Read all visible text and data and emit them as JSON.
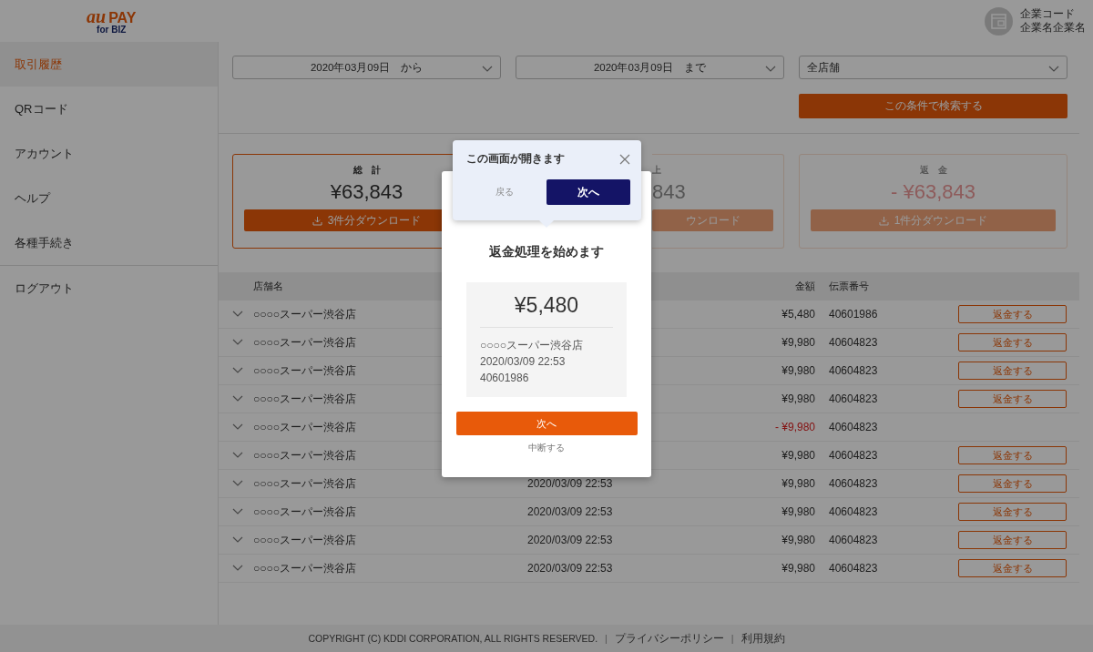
{
  "header": {
    "logo": {
      "brand": "au",
      "product": "PAY",
      "sub": "for BIZ"
    },
    "company": {
      "code": "企業コード",
      "name": "企業名企業名"
    }
  },
  "sidebar": {
    "items": [
      {
        "label": "取引履歴",
        "selected": true
      },
      {
        "label": "QRコード",
        "selected": false
      },
      {
        "label": "アカウント",
        "selected": false
      },
      {
        "label": "ヘルプ",
        "selected": false
      },
      {
        "label": "各種手続き",
        "selected": false
      }
    ],
    "logout": "ログアウト"
  },
  "filters": {
    "from": "2020年03月09日　から",
    "to": "2020年03月09日　まで",
    "store": "全店舗",
    "search_button": "この条件で検索する"
  },
  "summary_cards": [
    {
      "kind": "full",
      "title": "総　計",
      "amount": "¥63,843",
      "download": "3件分ダウンロード",
      "selected": true,
      "negative": false
    },
    {
      "kind": "covered",
      "title": "上",
      "amount": "843",
      "download": "ウンロード",
      "selected": false,
      "negative": false
    },
    {
      "kind": "full",
      "title": "返　金",
      "amount": "- ¥63,843",
      "download": "1件分ダウンロード",
      "selected": false,
      "negative": true
    }
  ],
  "table": {
    "columns": [
      "店舗名",
      "金額",
      "伝票番号"
    ],
    "rows": [
      {
        "store": "○○○○スーパー渋谷店",
        "amount": "¥5,480",
        "slip": "40601986",
        "refund": false,
        "button": "返金する"
      },
      {
        "store": "○○○○スーパー渋谷店",
        "amount": "¥9,980",
        "slip": "40604823",
        "refund": false,
        "button": "返金する"
      },
      {
        "store": "○○○○スーパー渋谷店",
        "amount": "¥9,980",
        "slip": "40604823",
        "refund": false,
        "button": "返金する"
      },
      {
        "store": "○○○○スーパー渋谷店",
        "amount": "¥9,980",
        "slip": "40604823",
        "refund": false,
        "button": "返金する"
      },
      {
        "store": "○○○○スーパー渋谷店",
        "amount": "- ¥9,980",
        "slip": "40604823",
        "refund": true
      },
      {
        "store": "○○○○スーパー渋谷店",
        "amount": "¥9,980",
        "slip": "40604823",
        "refund": false,
        "button": "返金する"
      },
      {
        "store": "○○○○スーパー渋谷店",
        "date": "2020/03/09 22:53",
        "amount": "¥9,980",
        "slip": "40604823",
        "refund": false,
        "button": "返金する"
      },
      {
        "store": "○○○○スーパー渋谷店",
        "date": "2020/03/09 22:53",
        "amount": "¥9,980",
        "slip": "40604823",
        "refund": false,
        "button": "返金する"
      },
      {
        "store": "○○○○スーパー渋谷店",
        "date": "2020/03/09 22:53",
        "amount": "¥9,980",
        "slip": "40604823",
        "refund": false,
        "button": "返金する"
      },
      {
        "store": "○○○○スーパー渋谷店",
        "date": "2020/03/09 22:53",
        "amount": "¥9,980",
        "slip": "40604823",
        "refund": false,
        "button": "返金する"
      }
    ]
  },
  "footer": {
    "copyright": "COPYRIGHT (C) KDDI CORPORATION, ALL RIGHTS RESERVED.",
    "links": [
      {
        "separator": "|",
        "label": "プライバシーポリシー"
      },
      {
        "separator": "|",
        "label": "利用規約"
      }
    ]
  },
  "popover": {
    "title": "この画面が開きます",
    "back": "戻る",
    "next": "次へ"
  },
  "dialog": {
    "title": "返金処理を始めます",
    "amount": "¥5,480",
    "store": "○○○○スーパー渋谷店",
    "datetime": "2020/03/09 22:53",
    "slip": "40601986",
    "next": "次へ",
    "cancel": "中断する"
  }
}
